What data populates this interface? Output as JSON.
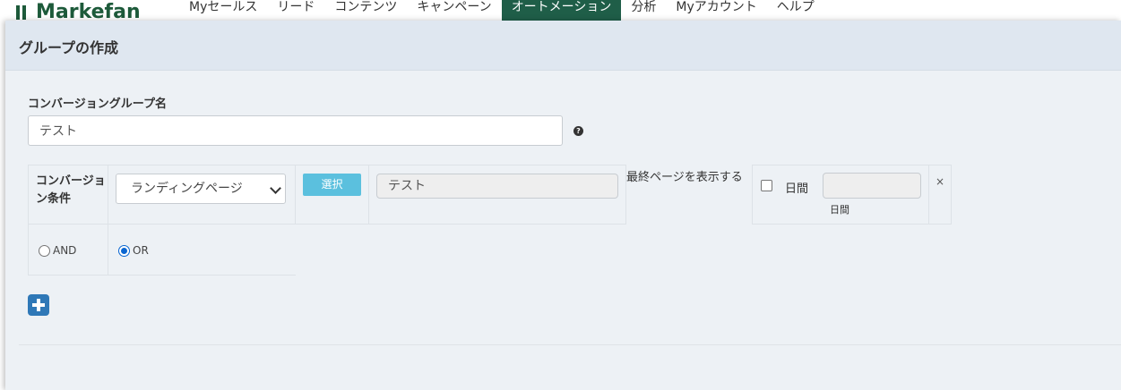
{
  "app": {
    "logo_text": "Markefan",
    "brand_color": "#1d5a3a",
    "nav": [
      "Myセールス",
      "リード",
      "コンテンツ",
      "キャンペーン",
      "オートメーション",
      "分析",
      "Myアカウント",
      "ヘルプ"
    ],
    "active_nav": "オートメーション"
  },
  "modal": {
    "title": "グループの作成",
    "group_name_label": "コンバージョングループ名",
    "group_name_value": "テスト",
    "help_icon": "question-circle-icon",
    "condition": {
      "label": "コンバージョン条件",
      "type_selected": "ランディングページ",
      "select_button": "選択",
      "page_value": "テスト",
      "last_page_label": "最終ページを表示する",
      "days_checkbox_checked": false,
      "days_label": "日間",
      "days_value": "",
      "days_sublabel": "日間",
      "remove_label": "×"
    },
    "logic": {
      "and_label": "AND",
      "or_label": "OR",
      "selected": "OR"
    },
    "add_icon": "plus-square-icon"
  }
}
